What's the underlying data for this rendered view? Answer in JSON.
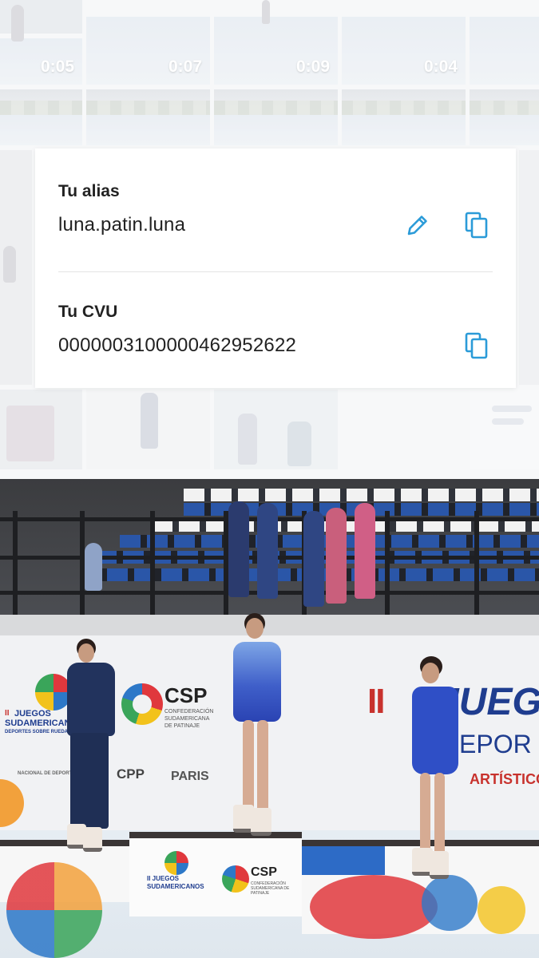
{
  "gallery": {
    "durations": [
      "0:05",
      "0:07",
      "0:09",
      "0:04"
    ]
  },
  "card": {
    "alias_label": "Tu alias",
    "alias_value": "luna.patin.luna",
    "cvu_label": "Tu CVU",
    "cvu_value": "0000003100000462952622",
    "icons": [
      "pencil-icon",
      "copy-icon"
    ],
    "accent_color": "#2b9bd8"
  },
  "photo": {
    "banner": {
      "event_prefix": "II",
      "event_name": "JUEGOS",
      "event_name_2": "SUDAMERICANOS",
      "event_tagline": "DEPORTES SOBRE RUEDAS",
      "right_big": "JUEG",
      "right_sub": "EPOR",
      "discipline": "ARTÍSTICO",
      "csp": "CSP",
      "csp_sub_1": "CONFEDERACIÓN",
      "csp_sub_2": "SUDAMERICANA",
      "csp_sub_3": "DE PATINAJE",
      "cpp": "CPP",
      "paris": "PARIS",
      "ministry": "NACIONAL DE DEPORTE"
    },
    "podium": {
      "event_prefix": "II JUEGOS",
      "event_name": "SUDAMERICANOS",
      "csp": "CSP",
      "csp_sub": "CONFEDERACIÓN SUDAMERICANA DE PATINAJE"
    }
  }
}
